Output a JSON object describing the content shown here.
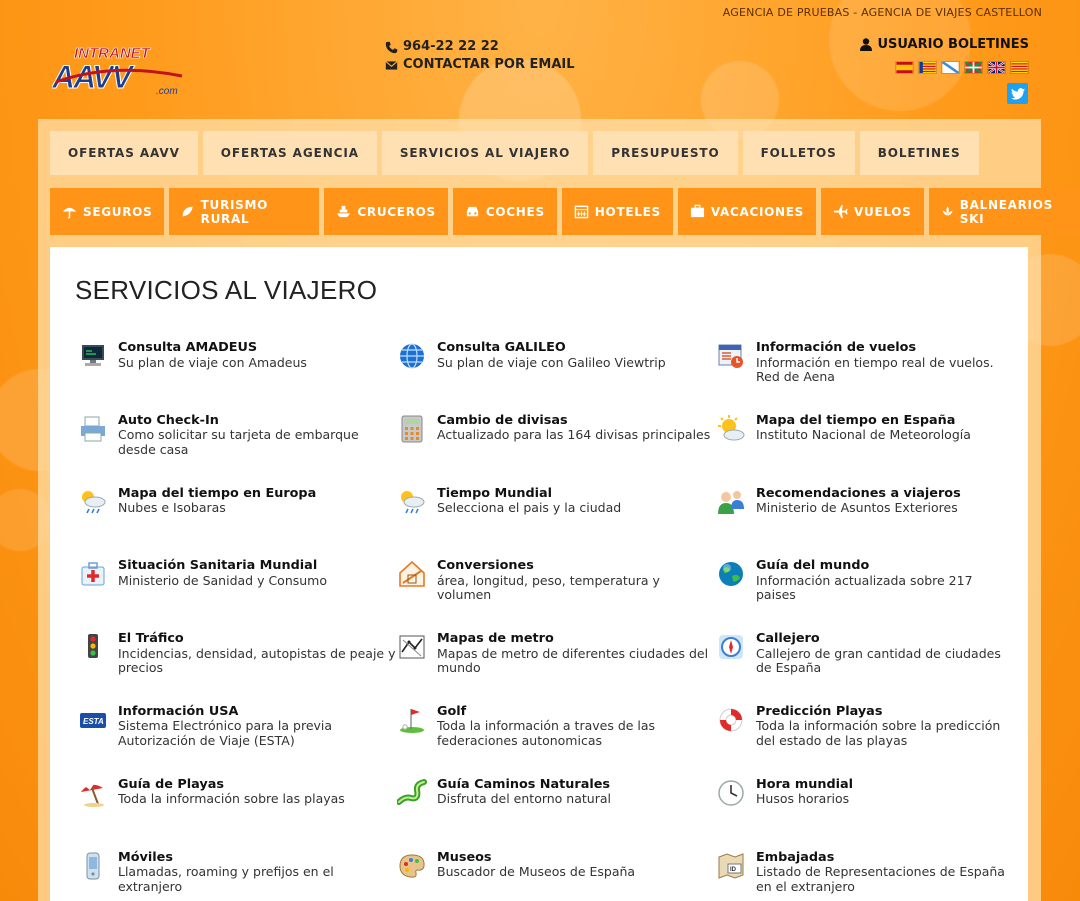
{
  "header": {
    "agency": "AGENCIA DE PRUEBAS - AGENCIA DE VIAJES CASTELLON",
    "logo_top": "INTRANET",
    "logo_main": "AAVV",
    "logo_suffix": ".com",
    "phone": "964-22 22 22",
    "email_label": "CONTACTAR POR EMAIL",
    "user_label": "USUARIO BOLETINES",
    "flags": [
      "spain-flag",
      "valencia-flag",
      "galicia-flag",
      "basque-flag",
      "uk-flag",
      "catalonia-flag"
    ]
  },
  "nav_main": [
    "OFERTAS AAVV",
    "OFERTAS AGENCIA",
    "SERVICIOS AL VIAJERO",
    "PRESUPUESTO",
    "FOLLETOS",
    "BOLETINES"
  ],
  "nav_services": [
    {
      "label": "SEGUROS",
      "icon": "umbrella-icon"
    },
    {
      "label": "TURISMO RURAL",
      "icon": "leaf-icon"
    },
    {
      "label": "CRUCEROS",
      "icon": "ship-icon"
    },
    {
      "label": "COCHES",
      "icon": "car-icon"
    },
    {
      "label": "HOTELES",
      "icon": "calendar-icon"
    },
    {
      "label": "VACACIONES",
      "icon": "suitcase-icon"
    },
    {
      "label": "VUELOS",
      "icon": "plane-icon"
    },
    {
      "label": "BALNEARIOS SKI",
      "icon": "spa-icon"
    }
  ],
  "page_title": "SERVICIOS AL VIAJERO",
  "services": [
    {
      "title": "Consulta AMADEUS",
      "desc": "Su plan de viaje con Amadeus",
      "icon": "computer-icon"
    },
    {
      "title": "Consulta GALILEO",
      "desc": "Su plan de viaje con Galileo Viewtrip",
      "icon": "globe-icon"
    },
    {
      "title": "Información de vuelos",
      "desc": "Información en tiempo real de vuelos. Red de Aena",
      "icon": "flight-info-icon"
    },
    {
      "title": "Auto Check-In",
      "desc": "Como solicitar su tarjeta de embarque desde casa",
      "icon": "printer-icon"
    },
    {
      "title": "Cambio de divisas",
      "desc": "Actualizado para las 164 divisas principales",
      "icon": "calculator-icon"
    },
    {
      "title": "Mapa del tiempo en España",
      "desc": "Instituto Nacional de Meteorología",
      "icon": "sun-cloud-icon"
    },
    {
      "title": "Mapa del tiempo en Europa",
      "desc": "Nubes e Isobaras",
      "icon": "weather-rain-icon"
    },
    {
      "title": "Tiempo Mundial",
      "desc": "Selecciona el pais y la ciudad",
      "icon": "weather-rain-icon"
    },
    {
      "title": "Recomendaciones a viajeros",
      "desc": "Ministerio de Asuntos Exteriores",
      "icon": "users-icon"
    },
    {
      "title": "Situación Sanitaria Mundial",
      "desc": "Ministerio de Sanidad y Consumo",
      "icon": "medical-kit-icon"
    },
    {
      "title": "Conversiones",
      "desc": "área, longitud, peso, temperatura y volumen",
      "icon": "house-measure-icon"
    },
    {
      "title": "Guía del mundo",
      "desc": "Información actualizada sobre 217 paises",
      "icon": "earth-icon"
    },
    {
      "title": "El Tráfico",
      "desc": "Incidencias, densidad, autopistas de peaje y precios",
      "icon": "traffic-light-icon"
    },
    {
      "title": "Mapas de metro",
      "desc": "Mapas de metro de diferentes ciudades del mundo",
      "icon": "metro-map-icon"
    },
    {
      "title": "Callejero",
      "desc": "Callejero de gran cantidad de ciudades de España",
      "icon": "compass-icon"
    },
    {
      "title": "Información USA",
      "desc": "Sistema Electrónico para la previa Autorización de Viaje (ESTA)",
      "icon": "esta-card-icon"
    },
    {
      "title": "Golf",
      "desc": "Toda la información a traves de las federaciones autonomicas",
      "icon": "golf-icon"
    },
    {
      "title": "Predicción Playas",
      "desc": "Toda la información sobre la predicción del estado de las playas",
      "icon": "lifebuoy-icon"
    },
    {
      "title": "Guía de Playas",
      "desc": "Toda la información sobre las playas",
      "icon": "beach-umbrella-icon"
    },
    {
      "title": "Guía Caminos Naturales",
      "desc": "Disfruta del entorno natural",
      "icon": "path-icon"
    },
    {
      "title": "Hora mundial",
      "desc": "Husos horarios",
      "icon": "clock-icon"
    },
    {
      "title": "Móviles",
      "desc": "Llamadas, roaming y prefijos en el extranjero",
      "icon": "mobile-icon"
    },
    {
      "title": "Museos",
      "desc": "Buscador de Museos de España",
      "icon": "palette-icon"
    },
    {
      "title": "Embajadas",
      "desc": "Listado de Representaciones de España en el extranjero",
      "icon": "map-id-icon"
    }
  ],
  "colors": {
    "accent": "#ff9418",
    "tab_bg": "#ffe0b3",
    "twitter": "#1da1f2"
  }
}
